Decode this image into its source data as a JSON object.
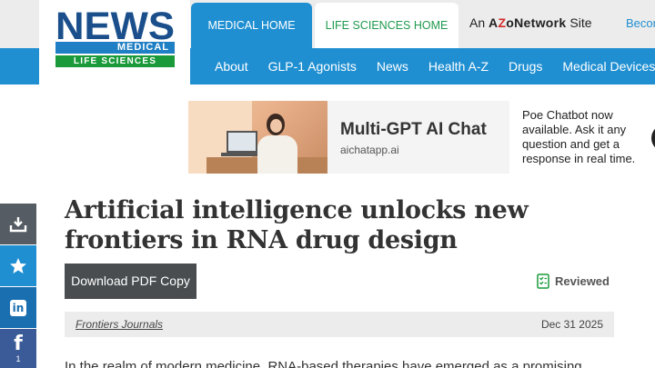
{
  "logo": {
    "news": "NEWS",
    "medical": "MEDICAL",
    "life_sciences": "LIFE SCIENCES"
  },
  "tabs": {
    "medical_home": "MEDICAL HOME",
    "life_sciences_home": "LIFE SCIENCES HOME"
  },
  "network": {
    "prefix": "An",
    "brand_a": "A",
    "brand_z": "Z",
    "brand_rest": "oNetwork",
    "suffix": "Site"
  },
  "become_link": "Becon",
  "nav": [
    "About",
    "GLP-1 Agonists",
    "News",
    "Health A-Z",
    "Drugs",
    "Medical Devices"
  ],
  "ad": {
    "title": "Multi-GPT AI Chat",
    "domain": "aichatapp.ai",
    "text": "Poe Chatbot now available. Ask it any question and get a response in real time."
  },
  "share": {
    "facebook_count": "1"
  },
  "article": {
    "title": "Artificial intelligence unlocks new frontiers in RNA drug design",
    "download_label": "Download PDF Copy",
    "reviewed_label": "Reviewed",
    "source": "Frontiers Journals",
    "date": "Dec 31 2025",
    "intro": "In the realm of modern medicine, RNA-based therapies have emerged as a promising"
  },
  "colors": {
    "primary_blue": "#1f8fd2",
    "green": "#1a9a3a",
    "button_dark": "#494d50",
    "facebook": "#3b5b98"
  }
}
